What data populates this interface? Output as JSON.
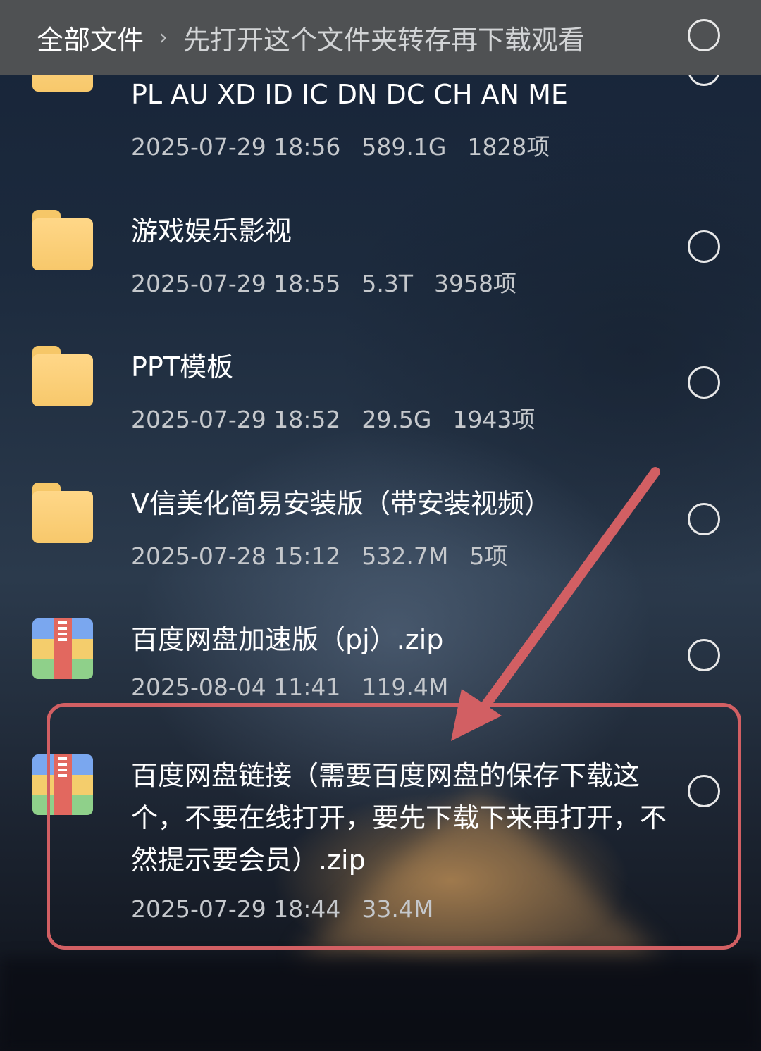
{
  "header": {
    "root": "全部文件",
    "separator": "›",
    "current_folder": "先打开这个文件夹转存再下载观看"
  },
  "items": [
    {
      "name": "PL AU XD ID IC DN DC CH AN ME",
      "date": "2025-07-29 18:56",
      "size": "589.1G",
      "count": "1828项",
      "type": "folder"
    },
    {
      "name": "游戏娱乐影视",
      "date": "2025-07-29 18:55",
      "size": "5.3T",
      "count": "3958项",
      "type": "folder"
    },
    {
      "name": "PPT模板",
      "date": "2025-07-29 18:52",
      "size": "29.5G",
      "count": "1943项",
      "type": "folder"
    },
    {
      "name": "V信美化简易安装版（带安装视频）",
      "date": "2025-07-28 15:12",
      "size": "532.7M",
      "count": "5项",
      "type": "folder"
    },
    {
      "name": "百度网盘加速版（pj）.zip",
      "date": "2025-08-04 11:41",
      "size": "119.4M",
      "type": "zip"
    },
    {
      "name": "百度网盘链接（需要百度网盘的保存下载这个，不要在线打开，要先下载下来再打开，不然提示要会员）.zip",
      "date": "2025-07-29 18:44",
      "size": "33.4M",
      "type": "zip"
    }
  ],
  "annotation": {
    "color": "#d25f63"
  },
  "icons": {
    "folder": "folder-icon",
    "zip": "zip-archive-icon",
    "select": "select-circle-icon"
  }
}
